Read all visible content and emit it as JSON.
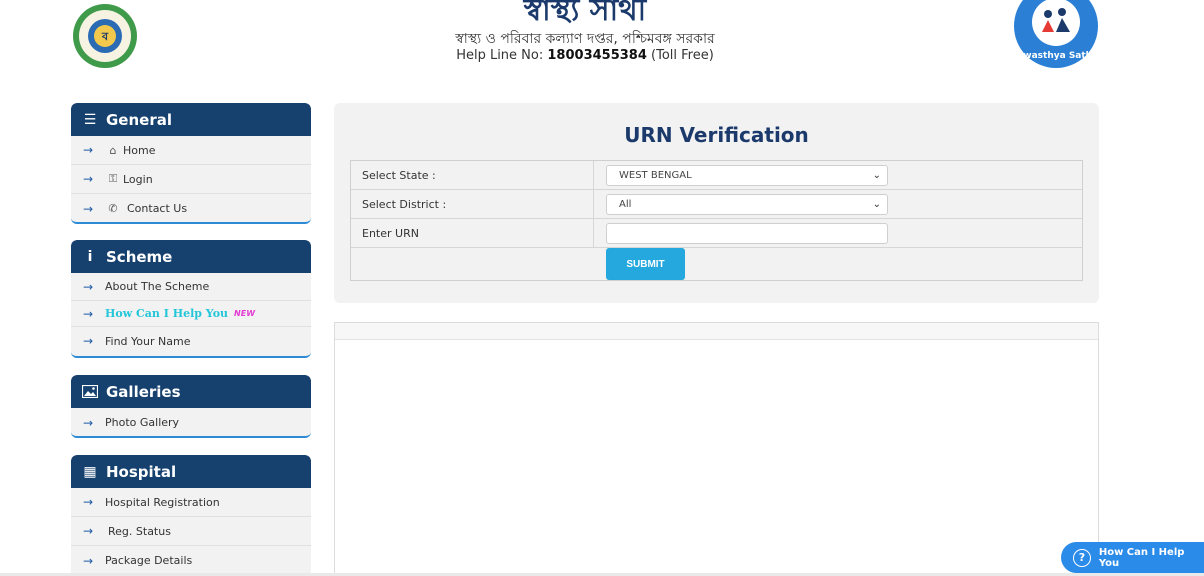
{
  "header": {
    "title": "স্বাস্থ্য সাথী",
    "subtitle": "স্বাস্থ্য ও পরিবার কল্যাণ দপ্তর, পশ্চিমবঙ্গ সরকার",
    "helpline_label": "Help Line No:",
    "helpline_number": "18003455384",
    "helpline_suffix": "(Toll Free)",
    "logo_text": "Swasthya Sathi"
  },
  "sidebar": {
    "general": {
      "title": "General",
      "items": [
        {
          "label": "Home",
          "icon": "home-icon"
        },
        {
          "label": "Login",
          "icon": "key-icon"
        },
        {
          "label": "Contact Us",
          "icon": "phone-icon"
        }
      ]
    },
    "scheme": {
      "title": "Scheme",
      "items": [
        {
          "label": "About The Scheme"
        },
        {
          "label": "How Can I Help You",
          "badge": "NEW"
        },
        {
          "label": "Find Your Name"
        }
      ]
    },
    "galleries": {
      "title": "Galleries",
      "items": [
        {
          "label": "Photo Gallery"
        }
      ]
    },
    "hospital": {
      "title": "Hospital",
      "items": [
        {
          "label": "Hospital Registration"
        },
        {
          "label": "Reg. Status"
        },
        {
          "label": "Package Details"
        }
      ]
    }
  },
  "main": {
    "title": "URN Verification",
    "state_label": "Select State :",
    "state_value": "WEST BENGAL",
    "district_label": "Select District :",
    "district_value": "All",
    "urn_label": "Enter URN",
    "urn_value": "",
    "submit_label": "SUBMIT"
  },
  "float_help": {
    "label": "How Can I Help You"
  },
  "colors": {
    "panel_header": "#16406e",
    "accent": "#25a8de",
    "title": "#1b3a6b"
  }
}
